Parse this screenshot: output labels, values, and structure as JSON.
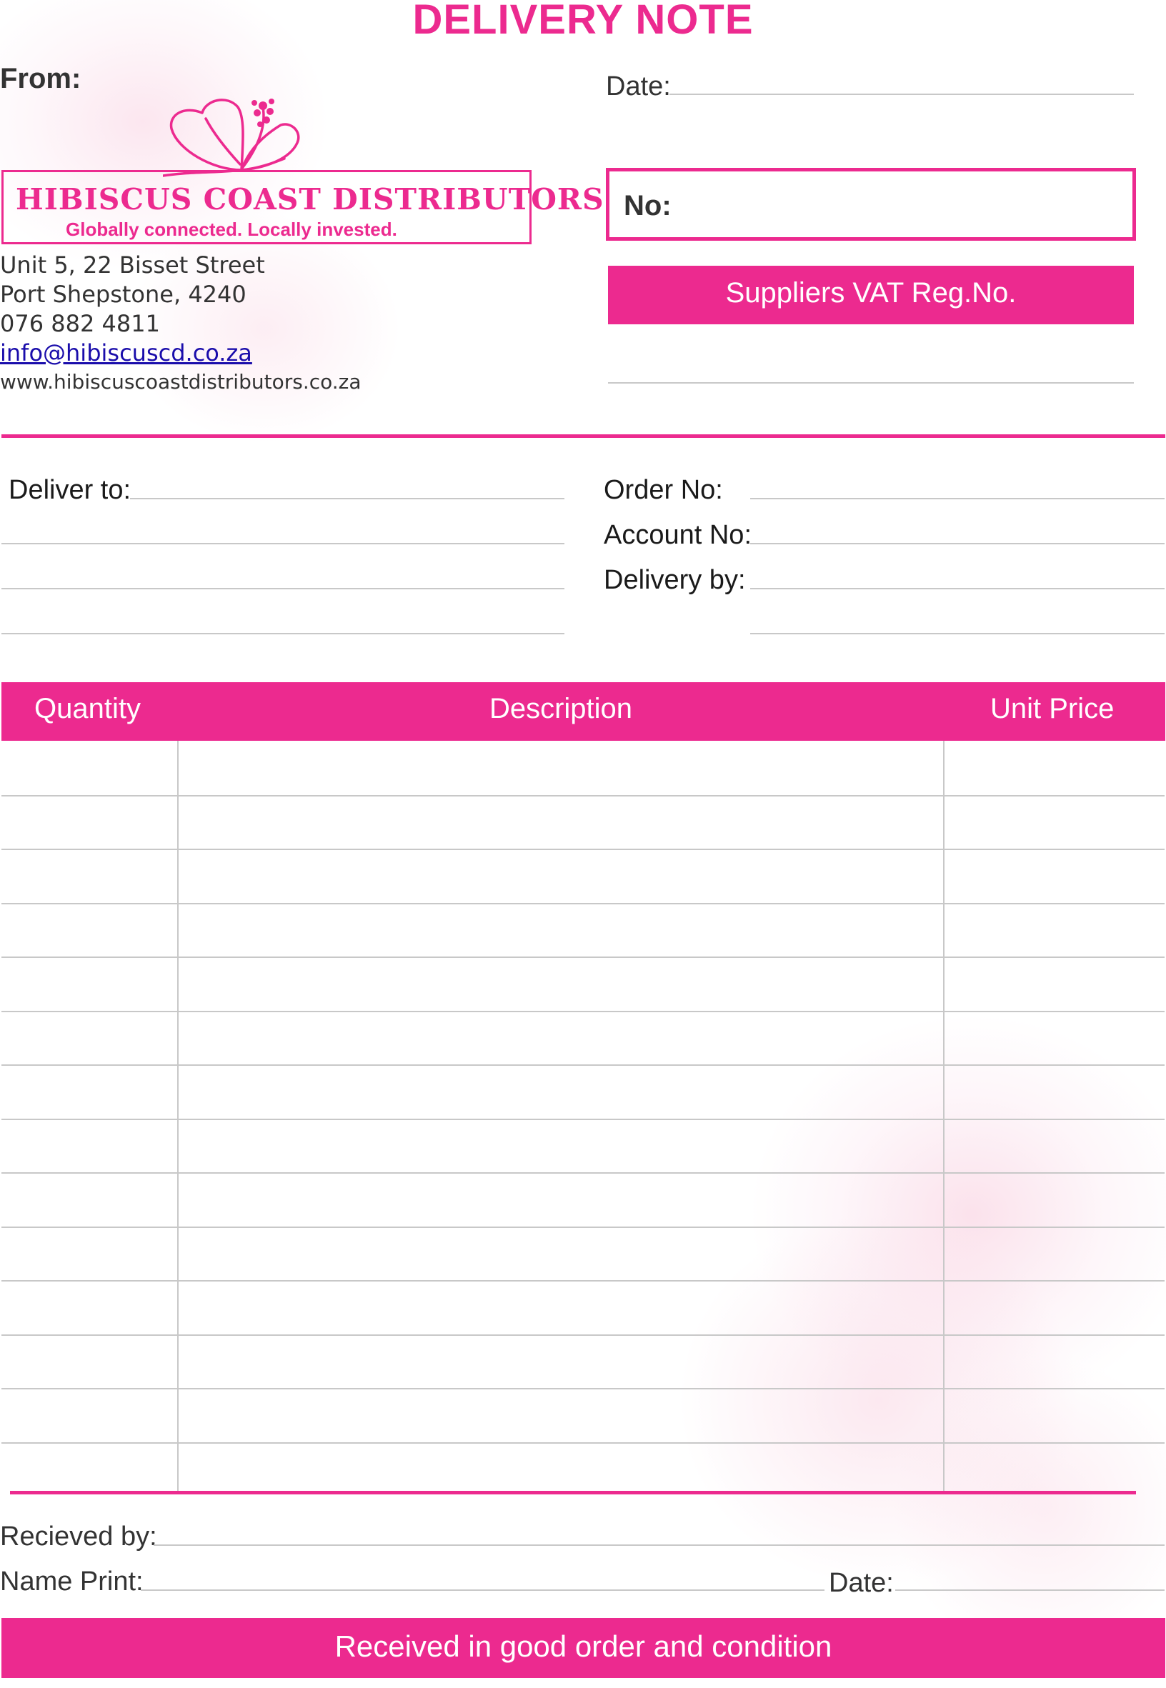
{
  "document": {
    "title": "DELIVERY NOTE",
    "from_label": "From:",
    "date_label": "Date:",
    "number_label": "No:",
    "vat_label": "Suppliers VAT Reg.No."
  },
  "company": {
    "name": "HIBISCUS COAST DISTRIBUTORS",
    "tagline": "Globally connected. Locally invested.",
    "address_line1": "Unit 5, 22 Bisset Street",
    "address_line2": "Port Shepstone, 4240",
    "phone": "076 882 4811",
    "email": "info@hibiscuscd.co.za",
    "website": "www.hibiscuscoastdistributors.co.za"
  },
  "delivery": {
    "deliver_to_label": "Deliver to:",
    "order_no_label": "Order No:",
    "account_no_label": "Account No:",
    "delivery_by_label": "Delivery by:"
  },
  "table": {
    "headers": [
      "Quantity",
      "Description",
      "Unit Price"
    ],
    "rows": 14
  },
  "signoff": {
    "received_by_label": "Recieved by:",
    "name_print_label": "Name Print:",
    "date_label": "Date:",
    "footer_text": "Received in good order and condition"
  },
  "colors": {
    "brand_pink": "#ec2a8f",
    "rule_gray": "#c8c8c8",
    "link_blue": "#1a0dab"
  },
  "icons": {
    "logo": "hibiscus-flower-icon"
  }
}
